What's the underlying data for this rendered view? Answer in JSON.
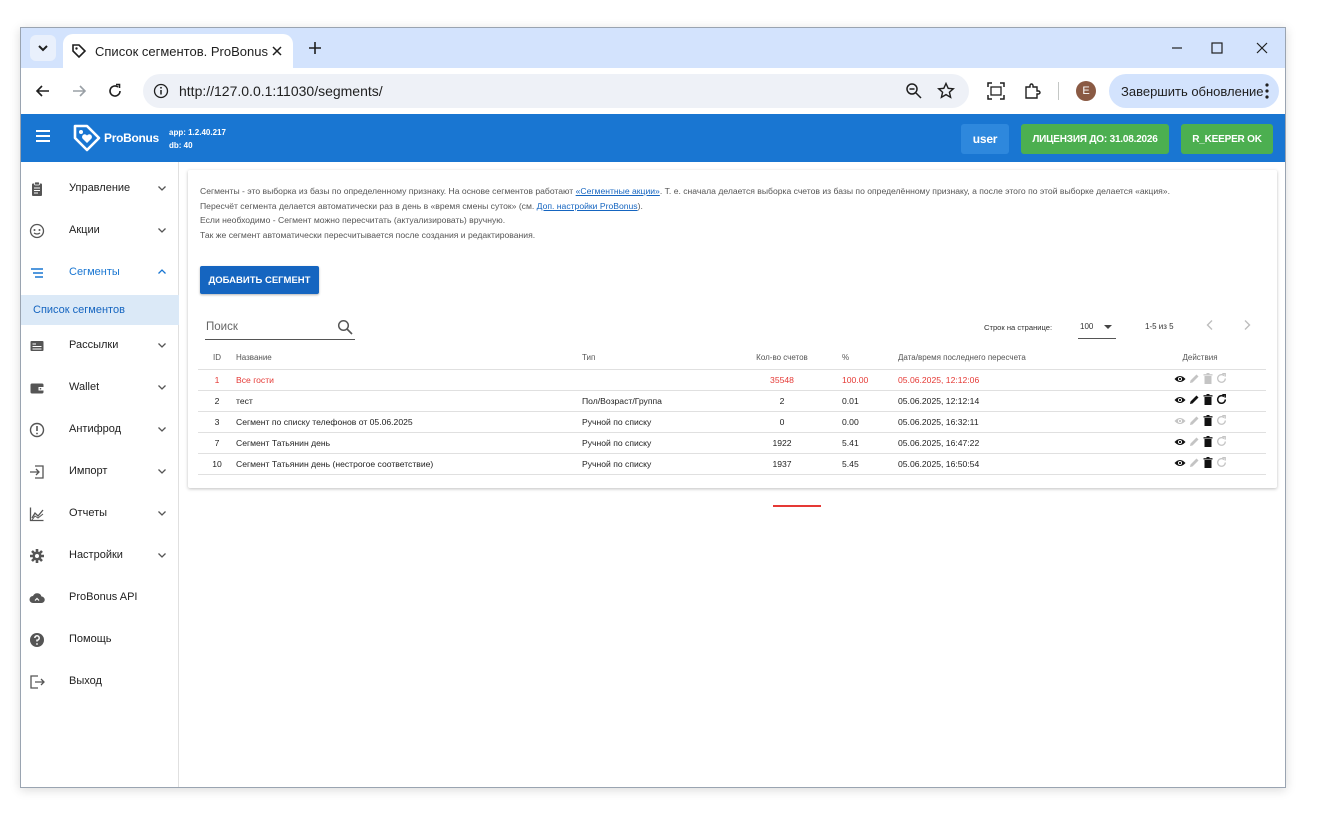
{
  "browser": {
    "tab_title": "Список сегментов. ProBonus",
    "url": "http://127.0.0.1:11030/segments/",
    "profile_initial": "E",
    "update_label": "Завершить обновление"
  },
  "header": {
    "logo_text": "ProBonus",
    "app_version": "app: 1.2.40.217",
    "db_version": "db: 40",
    "user_label": "user",
    "license_label": "ЛИЦЕНЗИЯ ДО: 31.08.2026",
    "rkeeper_label": "R_KEEPER OK"
  },
  "sidebar": {
    "items": [
      {
        "label": "Управление",
        "icon": "clipboard-icon"
      },
      {
        "label": "Акции",
        "icon": "eye-outline-icon"
      },
      {
        "label": "Сегменты",
        "icon": "segments-icon"
      },
      {
        "label": "Рассылки",
        "icon": "mailing-icon"
      },
      {
        "label": "Wallet",
        "icon": "wallet-icon"
      },
      {
        "label": "Антифрод",
        "icon": "alert-icon"
      },
      {
        "label": "Импорт",
        "icon": "import-icon"
      },
      {
        "label": "Отчеты",
        "icon": "chart-icon"
      },
      {
        "label": "Настройки",
        "icon": "gear-icon"
      },
      {
        "label": "ProBonus API",
        "icon": "cloud-icon"
      },
      {
        "label": "Помощь",
        "icon": "help-icon"
      },
      {
        "label": "Выход",
        "icon": "logout-icon"
      }
    ],
    "sub_item": "Список сегментов"
  },
  "info": {
    "line1_a": "Сегменты - это выборка из базы по определенному признаку. На основе сегментов работают ",
    "line1_link": "«Сегментные акции»",
    "line1_b": ". Т. е. сначала делается выборка счетов из базы по определённому признаку, а после этого по этой выборке делается «акция».",
    "line2_a": "Пересчёт сегмента делается автоматически раз в день в «время смены суток» (см. ",
    "line2_link": "Доп. настройки ProBonus",
    "line2_b": ").",
    "line3": "Если необходимо - Сегмент можно пересчитать (актуализировать) вручную.",
    "line4": "Так же сегмент автоматически пересчитывается после создания и редактирования."
  },
  "add_button": "ДОБАВИТЬ СЕГМЕНТ",
  "search": {
    "placeholder": "Поиск"
  },
  "pagination": {
    "rows_label": "Строк на странице:",
    "rows_value": "100",
    "range": "1-5 из 5"
  },
  "table": {
    "headers": {
      "id": "ID",
      "name": "Название",
      "type": "Тип",
      "count": "Кол-во счетов",
      "pct": "%",
      "datetime": "Дата/время последнего пересчета",
      "actions": "Действия"
    },
    "rows": [
      {
        "id": "1",
        "name": "Все гости",
        "type": "",
        "count": "35548",
        "pct": "100.00",
        "datetime": "05.06.2025, 12:12:06"
      },
      {
        "id": "2",
        "name": "тест",
        "type": "Пол/Возраст/Группа",
        "count": "2",
        "pct": "0.01",
        "datetime": "05.06.2025, 12:12:14"
      },
      {
        "id": "3",
        "name": "Сегмент по списку телефонов от 05.06.2025",
        "type": "Ручной по списку",
        "count": "0",
        "pct": "0.00",
        "datetime": "05.06.2025, 16:32:11"
      },
      {
        "id": "7",
        "name": "Сегмент Татьянин день",
        "type": "Ручной по списку",
        "count": "1922",
        "pct": "5.41",
        "datetime": "05.06.2025, 16:47:22"
      },
      {
        "id": "10",
        "name": "Сегмент Татьянин день (нестрогое соответствие)",
        "type": "Ручной по списку",
        "count": "1937",
        "pct": "5.45",
        "datetime": "05.06.2025, 16:50:54"
      }
    ]
  },
  "colors": {
    "brand_blue": "#1976d2",
    "license_green": "#4caf50",
    "highlight_red": "#e53935"
  }
}
